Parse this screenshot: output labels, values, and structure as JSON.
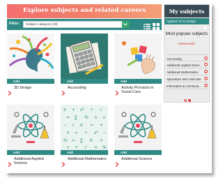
{
  "header": {
    "title": "Explore subjects and related careers"
  },
  "filter": {
    "label": "Filter:",
    "selected": "Subject category (All)"
  },
  "cards": [
    {
      "title": "3D Design",
      "image": "colorful-abstract-head-illustration"
    },
    {
      "title": "Accounting",
      "image": "calculator-on-paper-illustration"
    },
    {
      "title": "Activity Provision in Social Care",
      "image": "child-blocks-crayon-hand-illustration"
    },
    {
      "title": "Additional Applied Science",
      "image": "atom-microscope-illustration"
    },
    {
      "title": "Additional Mathematics",
      "image": "math-symbols-pattern"
    },
    {
      "title": "Additional Science",
      "image": "atom-microscope-illustration"
    }
  ],
  "card_add_label": "Add",
  "sidebar": {
    "title": "My subjects",
    "saved": [
      {
        "label": "Applied Art & Design",
        "icon": "thumbs-up-icon"
      }
    ],
    "popular_title": "Most popular subjects",
    "popular_subtitle": "Nationwide",
    "popular": [
      "Accounting",
      "Additional Applied Scien...",
      "Additional Mathematics",
      "Agriculture and Land Use",
      "Information & Communi..."
    ],
    "pager": {
      "pages": 2,
      "current": 2
    }
  },
  "colors": {
    "banner_gradient": [
      "#f26f6f",
      "#f4a078"
    ],
    "teal": "#2f8a85",
    "sidebar_header": "#3a4a54",
    "accent_red": "#d83a3a"
  }
}
